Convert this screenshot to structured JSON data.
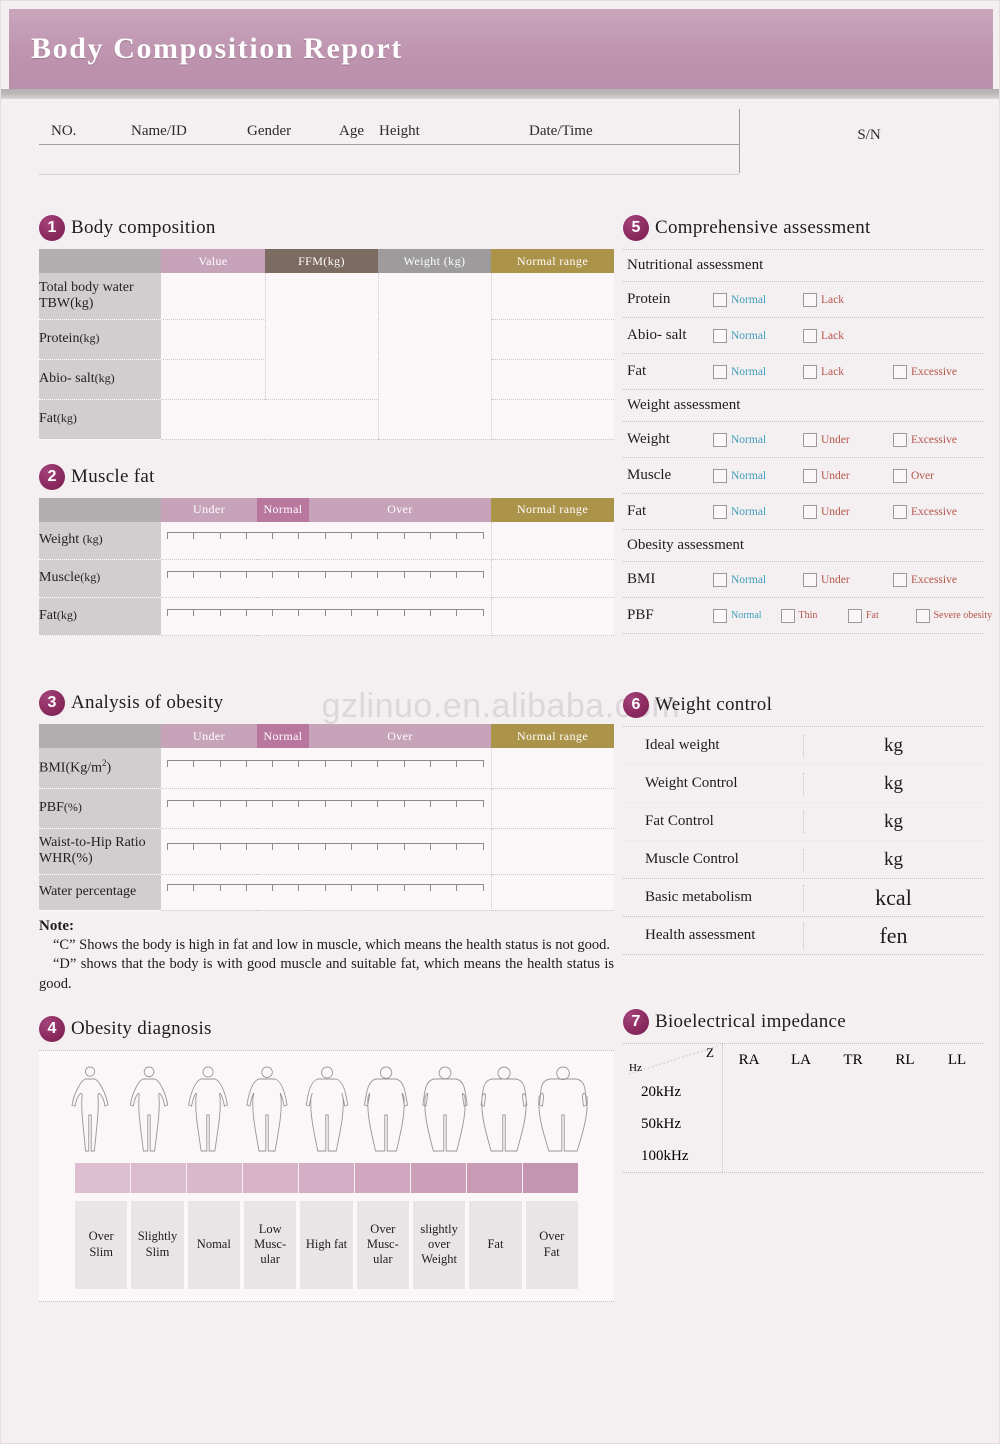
{
  "header": {
    "title": "Body Composition Report",
    "fields": [
      "NO.",
      "Name/ID",
      "Gender",
      "Age",
      "Height",
      "Date/Time"
    ],
    "sn_label": "S/N"
  },
  "watermark": "gzlinuo.en.alibaba.com",
  "colors": {
    "title_bar": "#bd93ae",
    "badge": "#8c2b60",
    "header_value": "#c6a3b8",
    "header_ffm": "#7c6b60",
    "header_weight": "#9e9b9c",
    "header_range": "#ab9349",
    "header_normal": "#b9779e",
    "row_label": "#d2ced0",
    "option_normal": "#3f9fbb",
    "option_warn": "#b5574d"
  },
  "section1": {
    "number": "1",
    "title": "Body composition",
    "headers": [
      "",
      "Value",
      "FFM(kg)",
      "Weight (kg)",
      "Normal range"
    ],
    "rows": [
      {
        "label_main": "Total body water",
        "label_sub": "TBW(kg)"
      },
      {
        "label_main": "Protein",
        "label_sub": "(kg)"
      },
      {
        "label_main": "Abio- salt",
        "label_sub": "(kg)"
      },
      {
        "label_main": "Fat",
        "label_sub": "(kg)"
      }
    ]
  },
  "section2": {
    "number": "2",
    "title": "Muscle fat",
    "headers": [
      "",
      "Under",
      "Normal",
      "Over",
      "Normal range"
    ],
    "rows": [
      {
        "label_main": "Weight",
        "label_sub": "(kg)"
      },
      {
        "label_main": "Muscle",
        "label_sub": "(kg)"
      },
      {
        "label_main": "Fat",
        "label_sub": "(kg)"
      }
    ]
  },
  "section3": {
    "number": "3",
    "title": "Analysis of obesity",
    "headers": [
      "",
      "Under",
      "Normal",
      "Over",
      "Normal range"
    ],
    "rows": [
      {
        "label_main": "BMI(Kg/m",
        "label_sub": ")",
        "sup": "2"
      },
      {
        "label_main": "PBF",
        "label_sub": "(%)"
      },
      {
        "label_main": "Waist-to-Hip Ratio",
        "label_sub": "WHR(%)"
      },
      {
        "label_main": "Water percentage",
        "label_sub": ""
      }
    ],
    "note_title": "Note:",
    "note_line1": "“C” Shows the body is high in fat and low in muscle, which means the health status is not good.",
    "note_line2": "“D”   shows that the body is with good muscle and suitable fat, which means the health status is good."
  },
  "section4": {
    "number": "4",
    "title": "Obesity diagnosis",
    "labels": [
      "Over\nSlim",
      "Slightly\nSlim",
      "Nomal",
      "Low\nMusc-\nular",
      "High fat",
      "Over\nMusc-\nular",
      "slightly\nover\nWeight",
      "Fat",
      "Over\nFat"
    ],
    "bar_colors": [
      "#ddbfd1",
      "#dbbcce",
      "#d9b8cb",
      "#d7b4c8",
      "#d4aec4",
      "#d0a7be",
      "#ccA0b9",
      "#c89ab4",
      "#c495b0"
    ]
  },
  "section5": {
    "number": "5",
    "title": "Comprehensive assessment",
    "groups": [
      {
        "name": "Nutritional assessment",
        "rows": [
          {
            "name": "Protein",
            "options": [
              {
                "label": "Normal",
                "kind": "normal"
              },
              {
                "label": "Lack",
                "kind": "warn"
              }
            ]
          },
          {
            "name": "Abio- salt",
            "options": [
              {
                "label": "Normal",
                "kind": "normal"
              },
              {
                "label": "Lack",
                "kind": "warn"
              }
            ]
          },
          {
            "name": "Fat",
            "options": [
              {
                "label": "Normal",
                "kind": "normal"
              },
              {
                "label": "Lack",
                "kind": "warn"
              },
              {
                "label": "Excessive",
                "kind": "warn"
              }
            ]
          }
        ]
      },
      {
        "name": "Weight assessment",
        "rows": [
          {
            "name": "Weight",
            "options": [
              {
                "label": "Normal",
                "kind": "normal"
              },
              {
                "label": "Under",
                "kind": "warn"
              },
              {
                "label": "Excessive",
                "kind": "warn"
              }
            ]
          },
          {
            "name": "Muscle",
            "options": [
              {
                "label": "Normal",
                "kind": "normal"
              },
              {
                "label": "Under",
                "kind": "warn"
              },
              {
                "label": "Over",
                "kind": "warn"
              }
            ]
          },
          {
            "name": "Fat",
            "options": [
              {
                "label": "Normal",
                "kind": "normal"
              },
              {
                "label": "Under",
                "kind": "warn"
              },
              {
                "label": "Excessive",
                "kind": "warn"
              }
            ]
          }
        ]
      },
      {
        "name": "Obesity assessment",
        "rows": [
          {
            "name": "BMI",
            "options": [
              {
                "label": "Normal",
                "kind": "normal"
              },
              {
                "label": "Under",
                "kind": "warn"
              },
              {
                "label": "Excessive",
                "kind": "warn"
              }
            ]
          },
          {
            "name": "PBF",
            "options": [
              {
                "label": "Normal",
                "kind": "normal"
              },
              {
                "label": "Thin",
                "kind": "warn"
              },
              {
                "label": "Fat",
                "kind": "warn"
              },
              {
                "label": "Severe obesity",
                "kind": "warn"
              }
            ]
          }
        ]
      }
    ]
  },
  "section6": {
    "number": "6",
    "title": "Weight control",
    "rows": [
      {
        "label": "Ideal weight",
        "unit": "kg"
      },
      {
        "label": "Weight Control",
        "unit": "kg"
      },
      {
        "label": "Fat Control",
        "unit": "kg"
      },
      {
        "label": "Muscle Control",
        "unit": "kg"
      },
      {
        "label": "Basic metabolism",
        "unit": "kcal"
      },
      {
        "label": "Health assessment",
        "unit": "fen"
      }
    ]
  },
  "section7": {
    "number": "7",
    "title": "Bioelectrical impedance",
    "corner_row": "Hz",
    "corner_col": "Z",
    "columns": [
      "RA",
      "LA",
      "TR",
      "RL",
      "LL"
    ],
    "frequencies": [
      "20kHz",
      "50kHz",
      "100kHz"
    ]
  }
}
